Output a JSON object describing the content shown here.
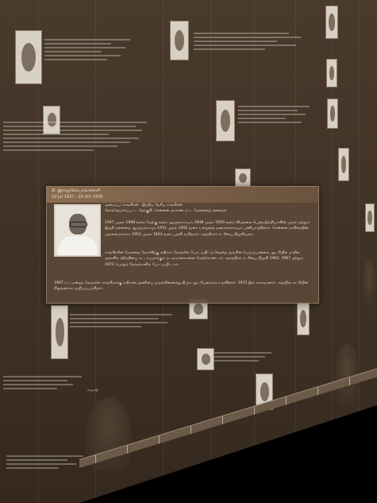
{
  "app": {
    "view": "3D timeline wall"
  },
  "card": {
    "name": "சி. இராஜகோபாலாச்சாரி",
    "dates": "10 Jul 1937 - 29 Oct 1939",
    "subtitle_1": "அமைப்பு: காங்கிரஸ் · இந்திய தேசிய காங்கிரஸ்",
    "subtitle_2": "தேர்ந்தெடுக்கப்பட்ட தொகுதி: சென்னை மாகாண சட்ட மேலவைத் தலைவர்",
    "para_1": "1947 முதல் 1948 வரை மேற்கு வங்க ஆளுநராகவும் 1948 முதல் 1950 வரை விடுதலை பெற்ற இந்தியாவின் முதல் மற்றும் இறுதி தலைமை ஆளுநராகவும் 1951 முதல் 1952 வரை உள்துறை அமைச்சராகவும் பணியாற்றினார். சென்னை மாநிலத்தின் முதலமைச்சராக 1952 முதல் 1954 வரை பதவி வகித்தார். சுதந்திராக் கட்சியை நிறுவியவர்.",
    "para_2": "காங்கிரசின் மேலவை நோக்கிற்கு எதிராக தேர்தலில் போட்டியிட்டு வென்ற அவரின் பெரும்பான்மை ஆட்சியில் மாநில அளவில் ஹிந்தியை கட்டாயமாக்கும் நடவடிக்கைகளை மேற்கொண்டார். கதர்த்திரக் கட்சியை நிறுவி 1962, 1967 மற்றும் 1972 பொதுத் தேர்தல்களில் போட்டியிட்டார்.",
    "para_3": "1967 சட்டமன்றத் தேர்தலில் காங்கிரசுக்கு எதிரான அணியை ஒருங்கிணைத்து திமுக ஆட்சியமைக்க உதவினார். 1972 இல் காலமானார். சுதந்திரா கட்சியின் நிறுவனராக அறியப்படுகிறார்."
  },
  "background": {
    "labels": [
      "ராஜாஜி",
      "1954",
      "1957",
      "1962",
      "1967",
      "1969",
      "1971",
      "1977",
      "1980",
      "1984",
      "1989",
      "1991"
    ]
  }
}
